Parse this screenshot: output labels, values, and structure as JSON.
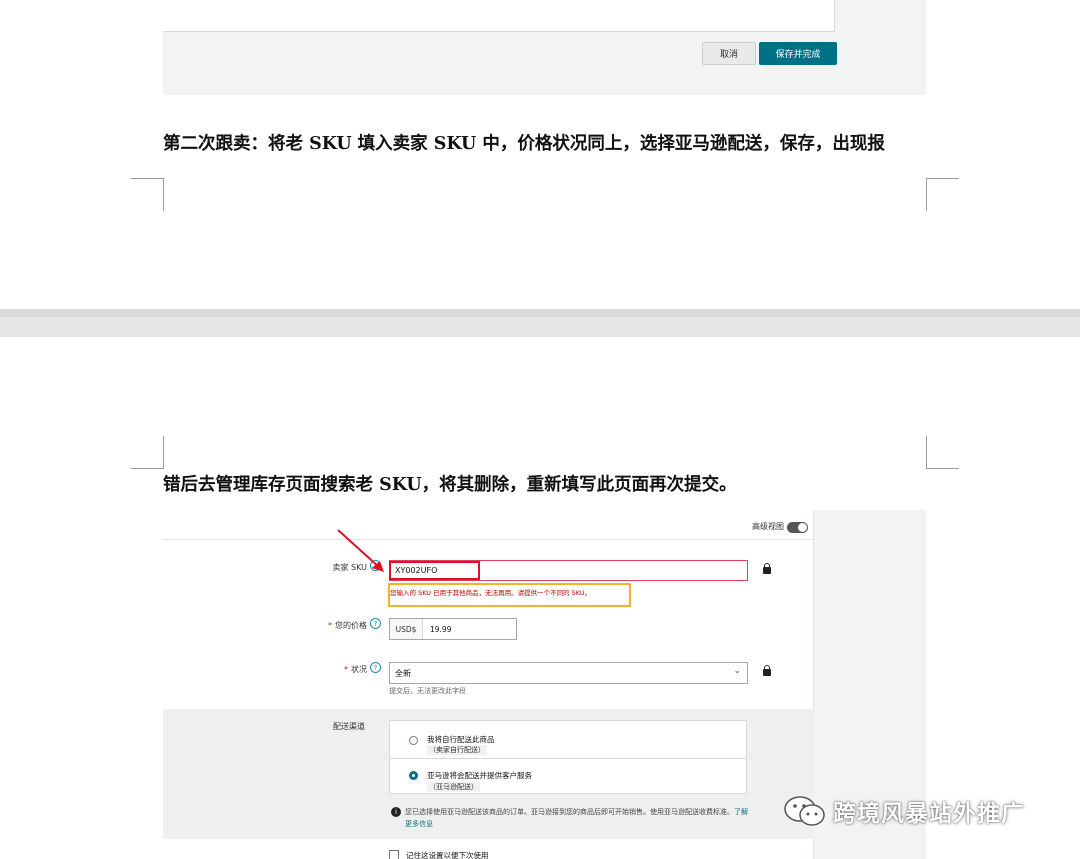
{
  "top_screenshot": {
    "cancel_label": "取消",
    "save_label": "保存并完成"
  },
  "paragraph_1": "第二次跟卖：将老 SKU 填入卖家 SKU 中，价格状况同上，选择亚马逊配送，保存，出现报",
  "paragraph_2": "错后去管理库存页面搜索老 SKU，将其删除，重新填写此页面再次提交。",
  "form": {
    "advanced_view_label": "高级视图",
    "seller_sku": {
      "label": "卖家 SKU",
      "value": "XY002UFO",
      "error": "您输入的 SKU 已用于其他商品，无法再用。请提供一个不同的 SKU。"
    },
    "price": {
      "label": "您的价格",
      "currency": "USD$",
      "value": "19.99"
    },
    "condition": {
      "label": "状况",
      "value": "全新",
      "note": "提交后，无法更改此字段"
    },
    "shipping": {
      "label": "配送渠道",
      "option_1_main": "我将自行配送此商品",
      "option_1_sub": "（卖家自行配送）",
      "option_2_main": "亚马逊将会配送并提供客户服务",
      "option_2_sub": "（亚马逊配送）",
      "selected": 2,
      "info_text": "您已选择使用亚马逊配送该商品的订单。亚马逊接到您的商品后即可开始销售。使用亚马逊配送收费标准。",
      "info_link": "了解更多信息"
    },
    "checkbox_label": "记住这设置以便下次使用"
  },
  "watermark": {
    "icon": "wechat-icon",
    "text": "跨境风暴站外推广"
  },
  "colors": {
    "accent": "#007185",
    "error_red": "#e0102a",
    "highlight_orange": "#f3b12c"
  }
}
